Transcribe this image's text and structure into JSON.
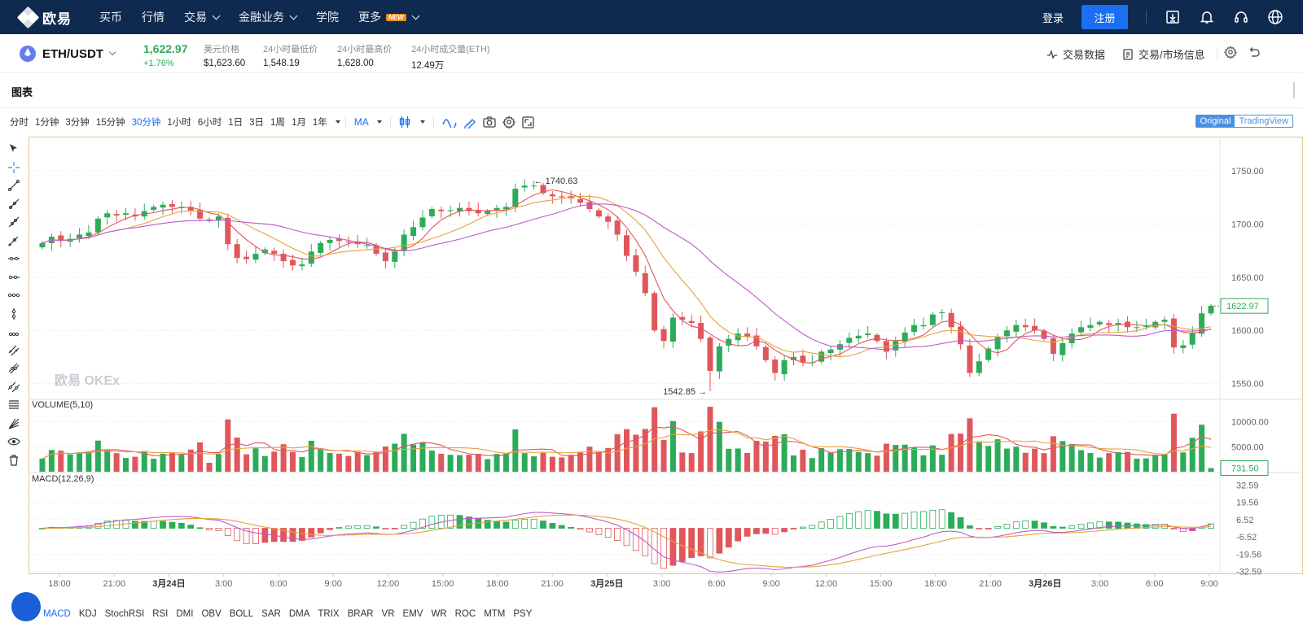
{
  "nav": {
    "brand": "欧易",
    "items": [
      {
        "label": "买币",
        "caret": false
      },
      {
        "label": "行情",
        "caret": false
      },
      {
        "label": "交易",
        "caret": true
      },
      {
        "label": "金融业务",
        "caret": true
      },
      {
        "label": "学院",
        "caret": false
      },
      {
        "label": "更多",
        "caret": true,
        "badge": "NEW"
      }
    ],
    "login": "登录",
    "register": "注册",
    "icons": [
      "download-icon",
      "bell-icon",
      "headset-icon",
      "globe-icon"
    ]
  },
  "ticker": {
    "pair": "ETH/USDT",
    "last_price": "1,622.97",
    "change": "+1.76%",
    "stats": [
      {
        "label": "美元价格",
        "value": "$1,623.60"
      },
      {
        "label": "24小时最低价",
        "value": "1,548.19"
      },
      {
        "label": "24小时最高价",
        "value": "1,628.00"
      },
      {
        "label": "24小时成交量(ETH)",
        "value": "12.49万"
      }
    ],
    "links": [
      "交易数据",
      "交易/市场信息"
    ]
  },
  "chart_panel": {
    "title": "图表",
    "intervals": [
      "分时",
      "1分钟",
      "3分钟",
      "15分钟",
      "30分钟",
      "1小时",
      "6小时",
      "1日",
      "3日",
      "1周",
      "1月",
      "1年"
    ],
    "active_interval": "30分钟",
    "indicator_select": "MA",
    "view_original": "Original",
    "view_tradingview": "TradingView",
    "watermark": "欧易 OKEx",
    "volume_label": "VOLUME(5,10)",
    "macd_label": "MACD(12,26,9)",
    "max_label": "← 1740.63",
    "min_label": "1542.85 →",
    "price_tag": "1622.97",
    "volume_tag": "731.50"
  },
  "indicators": [
    "MACD",
    "KDJ",
    "StochRSI",
    "RSI",
    "DMI",
    "OBV",
    "BOLL",
    "SAR",
    "DMA",
    "TRIX",
    "BRAR",
    "VR",
    "EMV",
    "WR",
    "ROC",
    "MTM",
    "PSY"
  ],
  "colors": {
    "up": "#2cac59",
    "down": "#e0575b",
    "ma1": "#e6a23c",
    "ma2": "#c05bc9",
    "accent": "#1a6ff2",
    "nav_bg": "#0e2a4e",
    "frame": "#e2c98b"
  },
  "chart_data": {
    "type": "candlestick",
    "interval": "30分钟",
    "x_ticks": [
      "18:00",
      "21:00",
      "3月24日",
      "3:00",
      "6:00",
      "9:00",
      "12:00",
      "15:00",
      "18:00",
      "21:00",
      "3月25日",
      "3:00",
      "6:00",
      "9:00",
      "12:00",
      "15:00",
      "18:00",
      "21:00",
      "3月26日",
      "3:00",
      "6:00",
      "9:00"
    ],
    "price_axis": {
      "ticks": [
        1550,
        1600,
        1650,
        1700,
        1750
      ],
      "tick_labels": [
        "1550.00",
        "1600.00",
        "1650.00",
        "1700.00",
        "1750.00"
      ],
      "range": [
        1536,
        1782
      ]
    },
    "volume_axis": {
      "ticks": [
        5000,
        10000
      ],
      "tick_labels": [
        "5000.00",
        "10000.00"
      ],
      "range": [
        0,
        13500
      ]
    },
    "macd_axis": {
      "ticks": [
        32.59,
        19.56,
        6.52,
        -6.52,
        -19.56,
        -32.59
      ],
      "tick_labels": [
        "32.59",
        "19.56",
        "6.52",
        "-6.52",
        "-19.56",
        "-32.59"
      ],
      "range": [
        -34,
        42
      ]
    },
    "high_marker": 1740.63,
    "low_marker": 1542.85,
    "last": 1622.97,
    "last_volume": 731.5,
    "close": [
      1682,
      1688,
      1684,
      1686,
      1690,
      1692,
      1705,
      1710,
      1708,
      1710,
      1707,
      1712,
      1716,
      1718,
      1716,
      1716,
      1712,
      1705,
      1703,
      1707,
      1681,
      1668,
      1667,
      1672,
      1676,
      1672,
      1665,
      1661,
      1662,
      1674,
      1682,
      1685,
      1684,
      1683,
      1681,
      1680,
      1672,
      1665,
      1674,
      1690,
      1697,
      1706,
      1714,
      1712,
      1713,
      1715,
      1712,
      1710,
      1712,
      1715,
      1716,
      1733,
      1736,
      1736,
      1729,
      1726,
      1725,
      1724,
      1720,
      1714,
      1707,
      1702,
      1690,
      1670,
      1655,
      1635,
      1600,
      1590,
      1612,
      1610,
      1607,
      1592,
      1562,
      1585,
      1592,
      1597,
      1594,
      1585,
      1572,
      1560,
      1572,
      1575,
      1570,
      1570,
      1580,
      1582,
      1587,
      1593,
      1595,
      1597,
      1590,
      1580,
      1590,
      1598,
      1605,
      1605,
      1615,
      1617,
      1603,
      1587,
      1560,
      1571,
      1583,
      1594,
      1600,
      1605,
      1603,
      1600,
      1592,
      1578,
      1588,
      1597,
      1603,
      1605,
      1608,
      1605,
      1607,
      1603,
      1603,
      1604,
      1608,
      1610,
      1584,
      1586,
      1598,
      1616,
      1623
    ]
  }
}
